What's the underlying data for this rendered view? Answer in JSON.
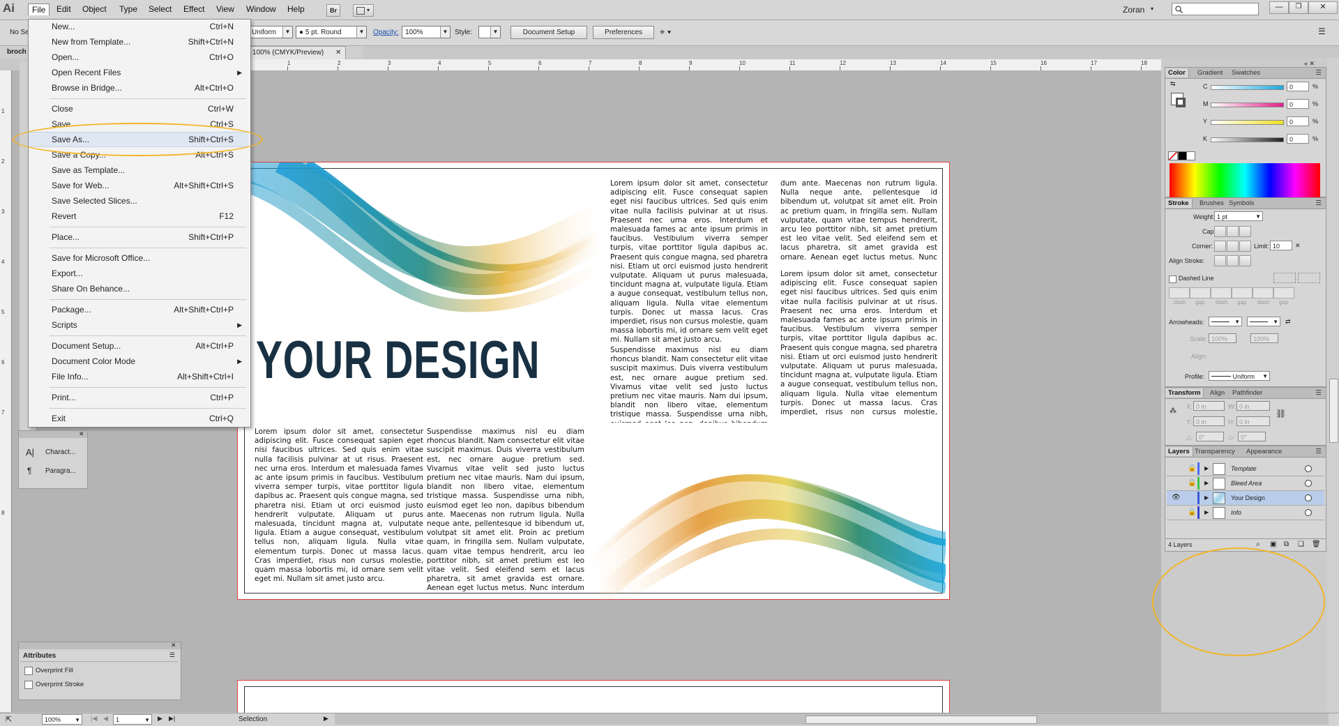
{
  "app": {
    "logo": "Ai",
    "user": "Zoran",
    "search_placeholder": ""
  },
  "menubar": {
    "items": [
      "File",
      "Edit",
      "Object",
      "Type",
      "Select",
      "Effect",
      "View",
      "Window",
      "Help"
    ],
    "bridge_button": "Br"
  },
  "controlbar": {
    "no_selection": "No Se",
    "stroke_profile": "Uniform",
    "brush": "5 pt. Round",
    "opacity_label": "Opacity:",
    "opacity_value": "100%",
    "style_label": "Style:",
    "document_setup": "Document Setup",
    "preferences": "Preferences"
  },
  "tabs": {
    "doc_name_partial": "broch",
    "doc_tab": "@ 100% (CMYK/Preview)"
  },
  "ruler_top": [
    "1",
    "2",
    "3",
    "4",
    "5",
    "6",
    "7",
    "8",
    "9",
    "10",
    "11",
    "12",
    "13",
    "14",
    "15",
    "16",
    "17",
    "18"
  ],
  "ruler_left": [
    "1",
    "2",
    "3",
    "4",
    "5",
    "6",
    "7",
    "8"
  ],
  "file_menu": {
    "items": [
      {
        "label": "New...",
        "shortcut": "Ctrl+N"
      },
      {
        "label": "New from Template...",
        "shortcut": "Shift+Ctrl+N"
      },
      {
        "label": "Open...",
        "shortcut": "Ctrl+O"
      },
      {
        "label": "Open Recent Files",
        "shortcut": "",
        "submenu": true
      },
      {
        "label": "Browse in Bridge...",
        "shortcut": "Alt+Ctrl+O"
      },
      {
        "label": "Close",
        "shortcut": "Ctrl+W"
      },
      {
        "label": "Save",
        "shortcut": "Ctrl+S"
      },
      {
        "label": "Save As...",
        "shortcut": "Shift+Ctrl+S"
      },
      {
        "label": "Save a Copy...",
        "shortcut": "Alt+Ctrl+S"
      },
      {
        "label": "Save as Template...",
        "shortcut": ""
      },
      {
        "label": "Save for Web...",
        "shortcut": "Alt+Shift+Ctrl+S"
      },
      {
        "label": "Save Selected Slices...",
        "shortcut": ""
      },
      {
        "label": "Revert",
        "shortcut": "F12"
      },
      {
        "label": "Place...",
        "shortcut": "Shift+Ctrl+P"
      },
      {
        "label": "Save for Microsoft Office...",
        "shortcut": ""
      },
      {
        "label": "Export...",
        "shortcut": ""
      },
      {
        "label": "Share On Behance...",
        "shortcut": ""
      },
      {
        "label": "Package...",
        "shortcut": "Alt+Shift+Ctrl+P"
      },
      {
        "label": "Scripts",
        "shortcut": "",
        "submenu": true
      },
      {
        "label": "Document Setup...",
        "shortcut": "Alt+Ctrl+P"
      },
      {
        "label": "Document Color Mode",
        "shortcut": "",
        "submenu": true
      },
      {
        "label": "File Info...",
        "shortcut": "Alt+Shift+Ctrl+I"
      },
      {
        "label": "Print...",
        "shortcut": "Ctrl+P"
      },
      {
        "label": "Exit",
        "shortcut": "Ctrl+Q"
      }
    ]
  },
  "document": {
    "headline": "YOUR DESIGN",
    "para_lorem": "Lorem ipsum dolor sit amet, consectetur adipiscing elit. Fusce consequat sapien eget nisi faucibus ultrices. Sed quis enim vitae nulla facilisis pulvinar at ut risus. Praesent nec urna eros. Interdum et malesuada fames ac ante ipsum primis in faucibus. Vestibulum viverra semper turpis, vitae porttitor ligula dapibus ac. Praesent quis congue magna, sed pharetra nisi. Etiam ut orci euismod justo hendrerit vulputate. Aliquam ut purus malesuada, tincidunt magna at, vulputate ligula. Etiam a augue consequat, vestibulum tellus non, aliquam ligula. Nulla vitae elementum turpis. Donec ut massa lacus. Cras imperdiet, risus non cursus molestie, quam massa lobortis mi, id ornare sem velit eget mi. Nullam sit amet justo arcu.",
    "para_susp": "Suspendisse maximus nisl eu diam rhoncus blandit. Nam consectetur elit vitae suscipit maximus. Duis viverra vestibulum est, nec ornare augue pretium sed. Vivamus vitae velit sed justo luctus pretium nec vitae mauris. Nam dui ipsum, blandit non libero vitae, elementum tristique massa. Suspendisse urna nibh, euismod eget leo non, dapibus bibendum ante. Maecenas non rutrum ligula. Nulla neque ante, pellentesque id bibendum ut, volutpat sit amet elit. Proin ac pretium quam, in fringilla sem. Nullam vulputate, quam vitae tempus hendrerit, arcu leo porttitor nibh, sit amet pretium est leo vitae velit. Sed eleifend sem et lacus pharetra, sit amet gravida est ornare. Aenean eget luctus metus. Nunc interdum nunc ac pharetra vehicula.",
    "para_col3b": "Suspendisse maximus nisl eu diam rhoncus blandit. Nam consectetur elit vitae suscipit maximus. Duis viverra vestibulum est, nec ornare augue pretium sed. Vivamus vitae velit sed justo luctus pretium nec vitae mauris. Nam dui ipsum, blandit non libero vitae, elementum tristique massa. Suspendisse urna nibh, euismod eget leo non, dapibus bibendum ante.",
    "para_col4a": "dum ante. Maecenas non rutrum ligula. Nulla neque ante, pellentesque id bibendum ut, volutpat sit amet elit. Proin ac pretium quam, in fringilla sem. Nullam vulputate, quam vitae tempus hendrerit, arcu leo porttitor nibh, sit amet pretium est leo vitae velit. Sed eleifend sem et lacus pharetra, sit amet gravida est ornare. Aenean eget luctus metus. Nunc interdum nunc ac pharetra vehicula."
  },
  "panels": {
    "char": {
      "character": "Charact...",
      "paragraph": "Paragra..."
    },
    "attributes": {
      "title": "Attributes",
      "overprint_fill": "Overprint Fill",
      "overprint_stroke": "Overprint Stroke"
    },
    "color": {
      "tabs": [
        "Color",
        "Gradient",
        "Swatches"
      ],
      "channels": [
        {
          "label": "C",
          "value": "0",
          "unit": "%",
          "color": "#1fa8e0"
        },
        {
          "label": "M",
          "value": "0",
          "unit": "%",
          "color": "#e0218a"
        },
        {
          "label": "Y",
          "value": "0",
          "unit": "%",
          "color": "#f0e020"
        },
        {
          "label": "K",
          "value": "0",
          "unit": "%",
          "color": "#222222"
        }
      ]
    },
    "stroke": {
      "tabs": [
        "Stroke",
        "Brushes",
        "Symbols"
      ],
      "weight_label": "Weight:",
      "weight": "1 pt",
      "cap_label": "Cap:",
      "corner_label": "Corner:",
      "limit_label": "Limit:",
      "limit": "10",
      "align_label": "Align Stroke:",
      "dashed_line": "Dashed Line",
      "dash_labels": [
        "dash",
        "gap",
        "dash",
        "gap",
        "dash",
        "gap"
      ],
      "arrowheads_label": "Arrowheads:",
      "scale_label": "Scale:",
      "scale1": "100%",
      "scale2": "100%",
      "align_label2": "Align:",
      "profile_label": "Profile:",
      "profile": "Uniform"
    },
    "transform": {
      "tabs": [
        "Transform",
        "Align",
        "Pathfinder"
      ],
      "x_label": "X:",
      "x": "0 in",
      "w_label": "W:",
      "w": "0 in",
      "y_label": "Y:",
      "y": "0 in",
      "h_label": "H:",
      "h": "0 in",
      "angle_label": "△:",
      "angle": "0°",
      "shear_label": "◇:",
      "shear": "0°"
    },
    "layers": {
      "tabs": [
        "Layers",
        "Transparency",
        "Appearance"
      ],
      "rows": [
        {
          "name": "Template",
          "locked": true,
          "visible": false,
          "color": "#4a6cf0"
        },
        {
          "name": "Bleed Area",
          "locked": true,
          "visible": false,
          "color": "#39c64a"
        },
        {
          "name": "Your Design",
          "locked": false,
          "visible": true,
          "color": "#3f57d8"
        },
        {
          "name": "Info",
          "locked": true,
          "visible": false,
          "color": "#2f45c8"
        }
      ],
      "count": "4 Layers"
    }
  },
  "statusbar": {
    "zoom": "100%",
    "page": "1",
    "tool": "Selection"
  }
}
